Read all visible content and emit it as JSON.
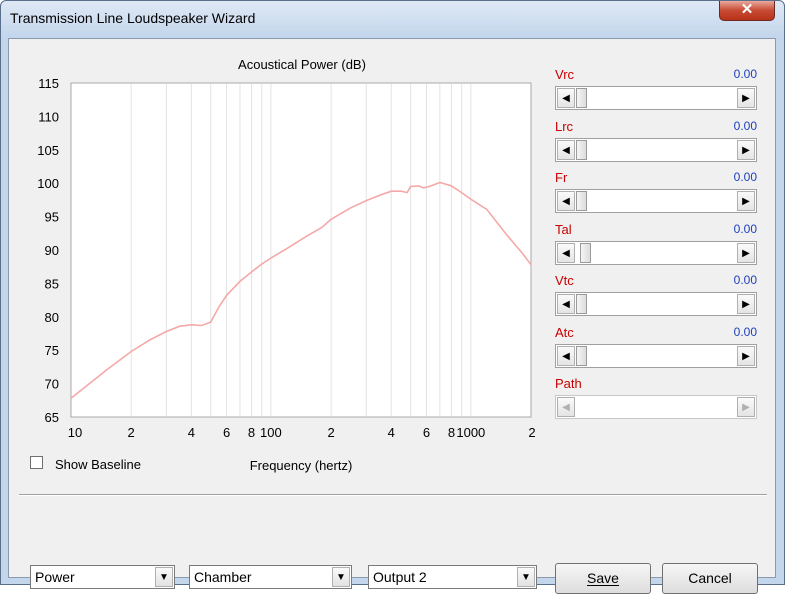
{
  "window": {
    "title": "Transmission Line Loudspeaker Wizard",
    "close_glyph": "✕"
  },
  "chart_data": {
    "type": "line",
    "title": "Acoustical Power (dB)",
    "xlabel": "Frequency (hertz)",
    "ylabel": "",
    "x_scale": "log",
    "xlim": [
      10,
      2000
    ],
    "ylim": [
      65,
      115
    ],
    "y_ticks": [
      65,
      70,
      75,
      80,
      85,
      90,
      95,
      100,
      105,
      110,
      115
    ],
    "x_ticks": [
      {
        "value": 10,
        "label": "10"
      },
      {
        "value": 20,
        "label": "2"
      },
      {
        "value": 40,
        "label": "4"
      },
      {
        "value": 60,
        "label": "6"
      },
      {
        "value": 80,
        "label": "8"
      },
      {
        "value": 100,
        "label": "100"
      },
      {
        "value": 200,
        "label": "2"
      },
      {
        "value": 400,
        "label": "4"
      },
      {
        "value": 600,
        "label": "6"
      },
      {
        "value": 800,
        "label": "8"
      },
      {
        "value": 1000,
        "label": "1000"
      },
      {
        "value": 2000,
        "label": "2"
      }
    ],
    "grid": true,
    "line_color": "#f4a9a8",
    "series": [
      {
        "x": [
          10,
          15,
          20,
          25,
          30,
          35,
          40,
          45,
          50,
          55,
          60,
          70,
          80,
          90,
          100,
          120,
          150,
          180,
          200,
          250,
          300,
          350,
          400,
          450,
          480,
          500,
          550,
          580,
          620,
          700,
          800,
          900,
          1000,
          1200,
          1500,
          1800,
          2000
        ],
        "y": [
          67.8,
          72.0,
          74.8,
          76.6,
          77.8,
          78.6,
          78.8,
          78.7,
          79.2,
          81.5,
          83.2,
          85.3,
          86.7,
          87.9,
          88.8,
          90.2,
          92.0,
          93.4,
          94.6,
          96.3,
          97.4,
          98.2,
          98.8,
          98.8,
          98.6,
          99.5,
          99.6,
          99.3,
          99.5,
          100.1,
          99.6,
          98.6,
          97.6,
          96.1,
          92.4,
          89.6,
          87.8
        ]
      }
    ]
  },
  "checkbox": {
    "label": "Show Baseline",
    "checked": false
  },
  "sliders": [
    {
      "label": "Vrc",
      "value": "0.00",
      "level": 0.0,
      "enabled": true
    },
    {
      "label": "Lrc",
      "value": "0.00",
      "level": 0.0,
      "enabled": true
    },
    {
      "label": "Fr",
      "value": "0.00",
      "level": 0.0,
      "enabled": true
    },
    {
      "label": "Tal",
      "value": "0.00",
      "level": 0.03,
      "enabled": true
    },
    {
      "label": "Vtc",
      "value": "0.00",
      "level": 0.0,
      "enabled": true
    },
    {
      "label": "Atc",
      "value": "0.00",
      "level": 0.0,
      "enabled": true
    },
    {
      "label": "Path",
      "value": "",
      "level": 0.0,
      "enabled": false
    }
  ],
  "dropdowns": [
    {
      "value": "Power"
    },
    {
      "value": "Chamber"
    },
    {
      "value": "Output 2"
    }
  ],
  "buttons": {
    "save": "Save",
    "cancel": "Cancel"
  },
  "colors": {
    "slider_label": "#c80000",
    "slider_value": "#1f3fbf",
    "plot_line": "#f4a9a8"
  },
  "icons": {
    "left": "◀",
    "right": "▶",
    "down": "▼"
  }
}
